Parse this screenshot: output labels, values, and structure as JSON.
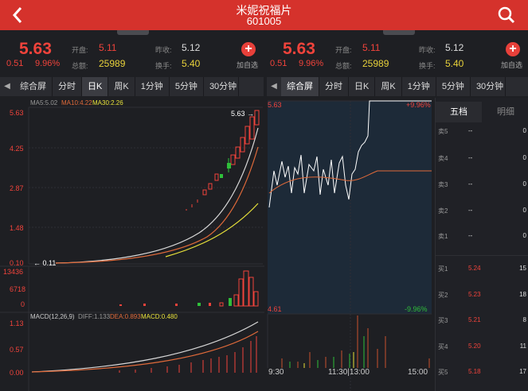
{
  "header": {
    "title": "米妮祝福片",
    "code": "601005"
  },
  "left_quote": {
    "price": "5.63",
    "change": "0.51",
    "percent": "9.96%",
    "open_label": "开盘:",
    "open": "5.11",
    "prev_label": "昨收:",
    "prev": "5.12",
    "amount_label": "总额:",
    "amount": "25989",
    "turnover_label": "换手:",
    "turnover": "5.40",
    "add_label": "加自选"
  },
  "right_quote": {
    "price": "5.63",
    "change": "0.51",
    "percent": "9.96%",
    "open_label": "开盘:",
    "open": "5.11",
    "prev_label": "昨收:",
    "prev": "5.12",
    "amount_label": "总额:",
    "amount": "25989",
    "turnover_label": "换手:",
    "turnover": "5.40",
    "add_label": "加自选"
  },
  "left_tabs": [
    "综合屏",
    "分时",
    "日K",
    "周K",
    "1分钟",
    "5分钟",
    "30分钟"
  ],
  "right_tabs": [
    "综合屏",
    "分时",
    "日K",
    "周K",
    "1分钟",
    "5分钟",
    "30分钟"
  ],
  "kline": {
    "ma_labels": {
      "ma5": "MA5:5.02",
      "ma10": "MA10:4.22",
      "ma30": "MA30:2.26"
    },
    "y_ticks": [
      "5.63",
      "4.25",
      "2.87",
      "1.48",
      "0.10"
    ],
    "high_label": "5.63",
    "low_label": "0.11",
    "vol_ticks": [
      "13436",
      "6718",
      "0"
    ],
    "macd_label": "MACD(12,26,9)",
    "diff_label": "DIFF:1.133",
    "dea_label": "DEA:0.893",
    "macd_val_label": "MACD:0.480",
    "macd_ticks": [
      "1.13",
      "0.57",
      "0.00"
    ]
  },
  "intraday": {
    "top_price": "5.63",
    "top_pct": "+9.96%",
    "bottom_price": "4.61",
    "bottom_pct": "-9.96%",
    "x_ticks": [
      "9:30",
      "11:30|13:00",
      "15:00"
    ]
  },
  "orderbook": {
    "tabs": [
      "五档",
      "明细"
    ],
    "asks": [
      {
        "side": "卖5",
        "price": "--",
        "vol": "0"
      },
      {
        "side": "卖4",
        "price": "--",
        "vol": "0"
      },
      {
        "side": "卖3",
        "price": "--",
        "vol": "0"
      },
      {
        "side": "卖2",
        "price": "--",
        "vol": "0"
      },
      {
        "side": "卖1",
        "price": "--",
        "vol": "0"
      }
    ],
    "bids": [
      {
        "side": "买1",
        "price": "5.24",
        "vol": "15"
      },
      {
        "side": "买2",
        "price": "5.23",
        "vol": "18"
      },
      {
        "side": "买3",
        "price": "5.21",
        "vol": "8"
      },
      {
        "side": "买4",
        "price": "5.20",
        "vol": "11"
      },
      {
        "side": "买5",
        "price": "5.18",
        "vol": "17"
      }
    ]
  },
  "colors": {
    "up": "#f0433b",
    "down": "#2fbf3a",
    "accent": "#d5322c"
  }
}
